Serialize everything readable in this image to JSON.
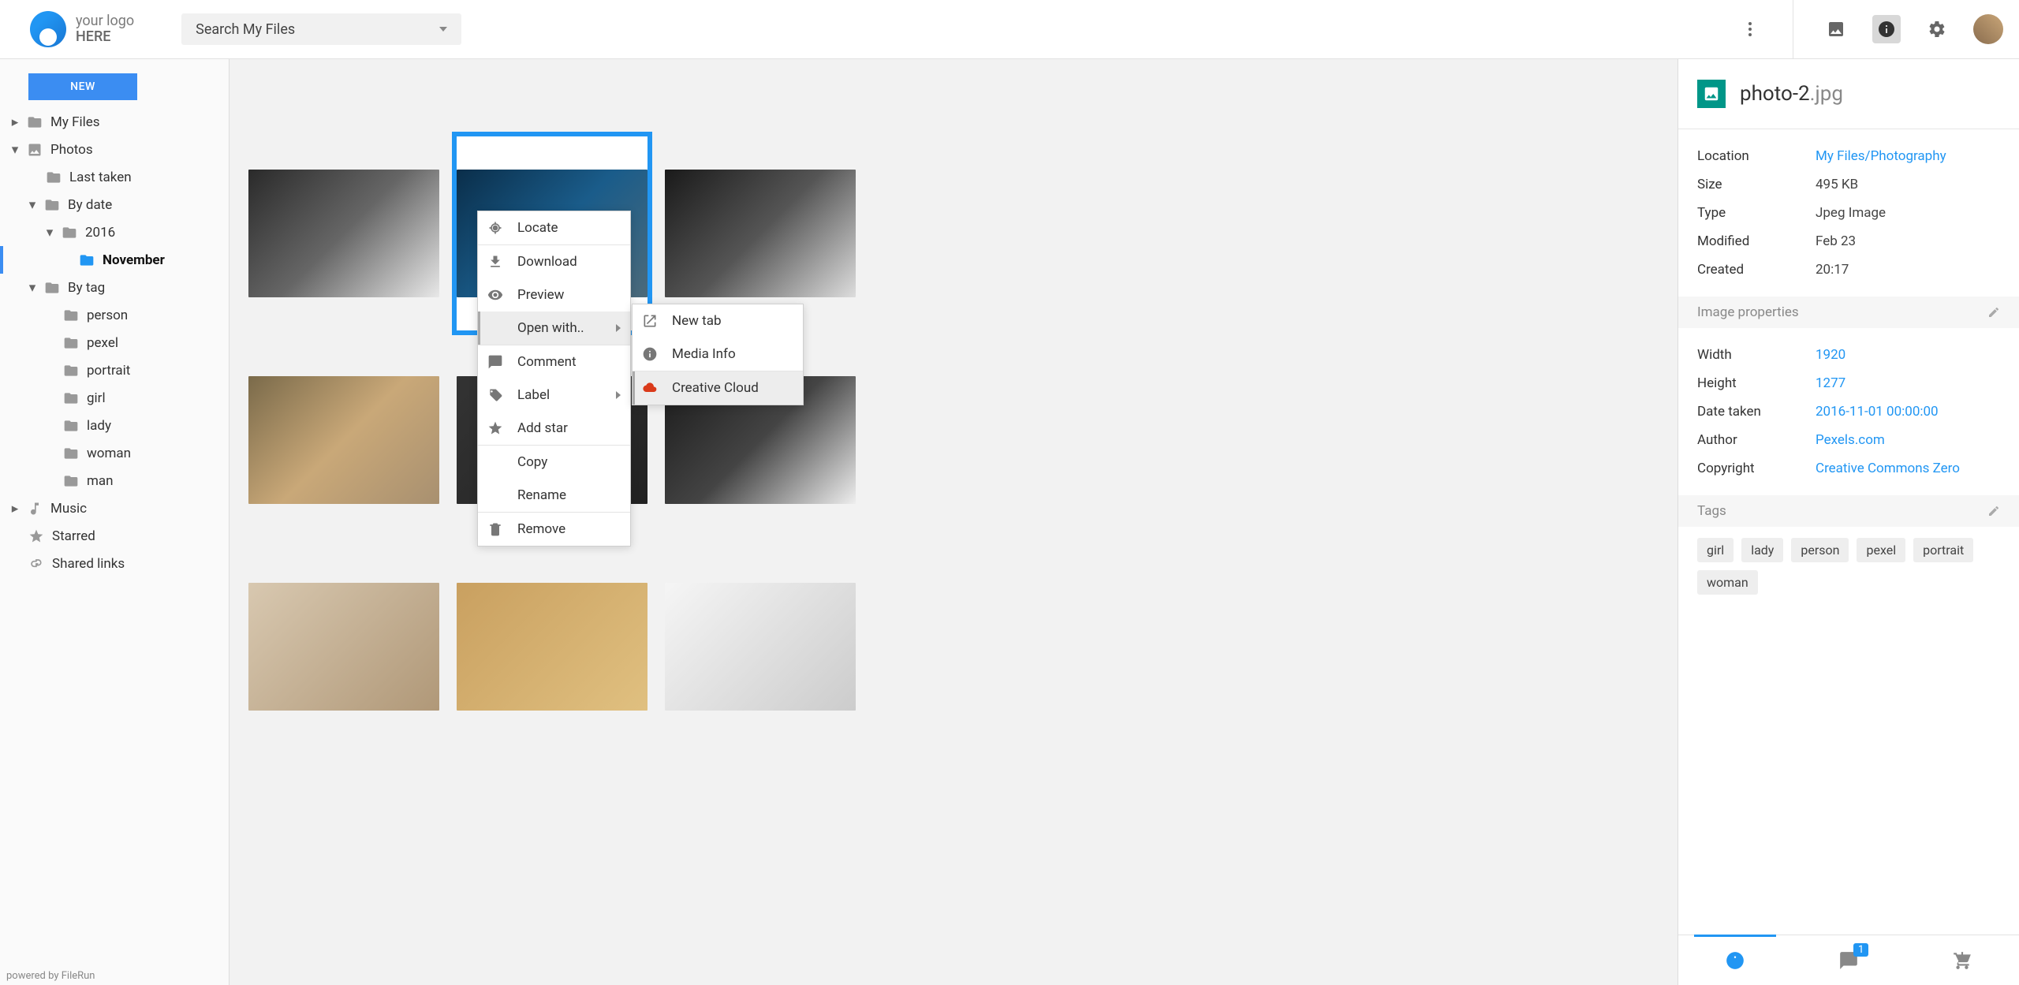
{
  "header": {
    "logo_line1": "your logo",
    "logo_line2": "HERE",
    "search_placeholder": "Search My Files"
  },
  "sidebar": {
    "new_label": "NEW",
    "powered": "powered by FileRun",
    "tree": {
      "my_files": "My Files",
      "photos": "Photos",
      "last_taken": "Last taken",
      "by_date": "By date",
      "y2016": "2016",
      "november": "November",
      "by_tag": "By tag",
      "tags": [
        "person",
        "pexel",
        "portrait",
        "girl",
        "lady",
        "woman",
        "man"
      ],
      "music": "Music",
      "starred": "Starred",
      "shared_links": "Shared links"
    }
  },
  "context_menu": {
    "locate": "Locate",
    "download": "Download",
    "preview": "Preview",
    "open_with": "Open with..",
    "comment": "Comment",
    "label": "Label",
    "add_star": "Add star",
    "copy": "Copy",
    "rename": "Rename",
    "remove": "Remove",
    "sub": {
      "new_tab": "New tab",
      "media_info": "Media Info",
      "creative_cloud": "Creative Cloud"
    }
  },
  "details": {
    "file_base": "photo-2",
    "file_ext": ".jpg",
    "rows": {
      "location_k": "Location",
      "location_v": "My Files/Photography",
      "size_k": "Size",
      "size_v": "495 KB",
      "type_k": "Type",
      "type_v": "Jpeg Image",
      "modified_k": "Modified",
      "modified_v": "Feb 23",
      "created_k": "Created",
      "created_v": "20:17"
    },
    "img_props_label": "Image properties",
    "img_props": {
      "width_k": "Width",
      "width_v": "1920",
      "height_k": "Height",
      "height_v": "1277",
      "date_k": "Date taken",
      "date_v": "2016-11-01 00:00:00",
      "author_k": "Author",
      "author_v": "Pexels.com",
      "copyright_k": "Copyright",
      "copyright_v": "Creative Commons Zero"
    },
    "tags_label": "Tags",
    "tags": [
      "girl",
      "lady",
      "person",
      "pexel",
      "portrait",
      "woman"
    ],
    "comment_badge": "1"
  }
}
